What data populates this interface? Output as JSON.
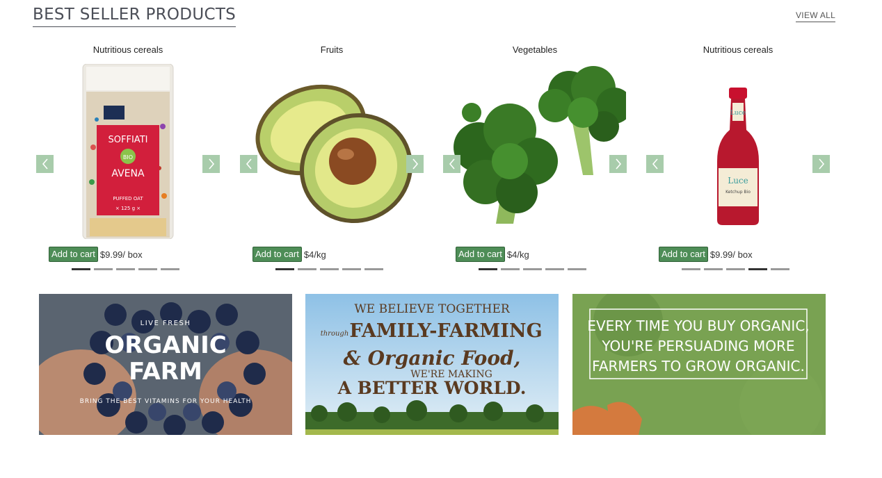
{
  "section": {
    "title": "BEST SELLER PRODUCTS",
    "view_all": "VIEW ALL"
  },
  "products": [
    {
      "name": "Nutritious cereals",
      "button": "Add to cart",
      "price": "$9.99/ box",
      "image": "puffed-oat-package-icon",
      "active_dot": 1
    },
    {
      "name": "Fruits",
      "button": "Add to cart",
      "price": "$4/kg",
      "image": "avocado-icon",
      "active_dot": 1
    },
    {
      "name": "Vegetables",
      "button": "Add to cart",
      "price": "$4/kg",
      "image": "broccoli-icon",
      "active_dot": 1
    },
    {
      "name": "Nutritious cereals",
      "button": "Add to cart",
      "price": "$9.99/ box",
      "image": "ketchup-bottle-icon",
      "active_dot": 4
    }
  ],
  "package": {
    "brand_line": "SOFFIATI",
    "badge": "BIO",
    "product": "AVENA",
    "sub1": "PUFFED OAT",
    "weight": "× 125 g ×"
  },
  "bottle": {
    "brand": "Luce",
    "label": "Ketchup Bio"
  },
  "banners": [
    {
      "top": "LIVE FRESH",
      "title1": "ORGANIC",
      "title2": "FARM",
      "bottom": "BRING THE BEST VITAMINS FOR YOUR HEALTH"
    },
    {
      "line1": "WE BELIEVE TOGETHER",
      "through": "through",
      "line2": "FAMILY-FARMING",
      "line3": "& Organic Food,",
      "line4": "WE'RE MAKING",
      "line5": "A BETTER WORLD."
    },
    {
      "line1": "EVERY TIME YOU BUY ORGANIC,",
      "line2": "YOU'RE PERSUADING MORE",
      "line3": "FARMERS TO GROW ORGANIC."
    }
  ],
  "colors": {
    "accent_green": "#4e8d57",
    "arrow_bg": "#a8ccab",
    "title": "#4b4e57"
  }
}
